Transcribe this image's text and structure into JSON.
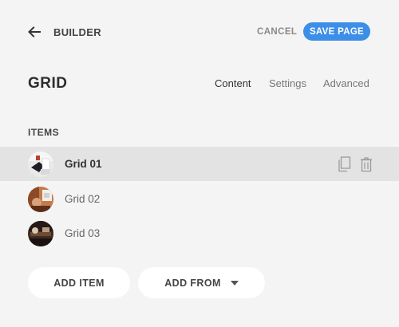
{
  "header": {
    "builder_label": "BUILDER",
    "cancel_label": "CANCEL",
    "save_label": "SAVE PAGE",
    "accent_color": "#3c8ee8"
  },
  "page": {
    "title": "GRID"
  },
  "tabs": [
    {
      "label": "Content",
      "active": true
    },
    {
      "label": "Settings",
      "active": false
    },
    {
      "label": "Advanced",
      "active": false
    }
  ],
  "items_section": {
    "label": "ITEMS",
    "items": [
      {
        "label": "Grid 01",
        "selected": true,
        "thumbnail": "grid-01-photo"
      },
      {
        "label": "Grid 02",
        "selected": false,
        "thumbnail": "grid-02-photo"
      },
      {
        "label": "Grid 03",
        "selected": false,
        "thumbnail": "grid-03-photo"
      }
    ],
    "row_action_icons": [
      "copy-icon",
      "trash-icon"
    ]
  },
  "footer": {
    "add_item_label": "ADD ITEM",
    "add_from_label": "ADD FROM"
  }
}
